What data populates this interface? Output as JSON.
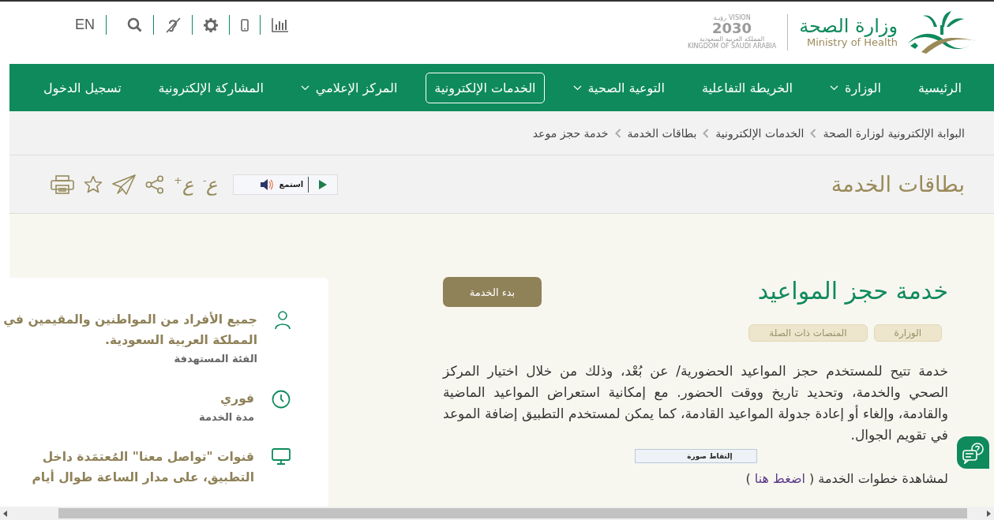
{
  "header": {
    "logo_ar": "وزارة الصحة",
    "logo_en": "Ministry of Health",
    "vision_en": "VISION",
    "vision_ar": "رؤيـة",
    "vision_year": "2030",
    "vision_sub_ar": "المملكة العربية السعودية",
    "vision_sub_en": "KINGDOM OF SAUDI ARABIA"
  },
  "toolbar": {
    "language": "EN"
  },
  "nav": [
    {
      "label": "الرئيسية",
      "dropdown": false,
      "selected": false
    },
    {
      "label": "الوزارة",
      "dropdown": true,
      "selected": false
    },
    {
      "label": "الخريطة التفاعلية",
      "dropdown": false,
      "selected": false
    },
    {
      "label": "التوعية الصحية",
      "dropdown": true,
      "selected": false
    },
    {
      "label": "الخدمات الإلكترونية",
      "dropdown": false,
      "selected": true
    },
    {
      "label": "المركز الإعلامي",
      "dropdown": true,
      "selected": false
    },
    {
      "label": "المشاركة الإلكترونية",
      "dropdown": false,
      "selected": false
    },
    {
      "label": "تسجيل الدخول",
      "dropdown": false,
      "selected": false
    }
  ],
  "breadcrumb": [
    "البوابة الإلكترونية لوزارة الصحة",
    "الخدمات الإلكترونية",
    "بطاقات الخدمة",
    "خدمة حجز موعد"
  ],
  "page_title": "بطاقات الخدمة",
  "listen": {
    "label": "استمع"
  },
  "font_controls": [
    {
      "glyph": "ع",
      "sign": "-"
    },
    {
      "glyph": "ع",
      "sign": "+"
    }
  ],
  "service": {
    "title": "خدمة حجز المواعيد",
    "start_button": "بدء الخدمة",
    "tags": [
      "الوزارة",
      "المنصات ذات الصلة"
    ],
    "description": "خدمة تتيح للمستخدم حجز المواعيد الحضورية/ عن بُعْد، وذلك من خلال اختيار المركز الصحي والخدمة، وتحديد تاريخ ووقت الحضور. مع إمكانية استعراض المواعيد الماضية والقادمة، وإلغاء أو إعادة جدولة المواعيد القادمة، كما يمكن لمستخدم التطبيق إضافة الموعد في تقويم الجوال.",
    "steps_prefix": "لمشاهدة خطوات الخدمة (",
    "steps_link": "اضغط هنا",
    "steps_suffix": ")"
  },
  "details": [
    {
      "kind": "audience",
      "value": "جميع الأفراد من المواطنين والمقيمين في المملكة العربية السعودية.",
      "label": "الفئة المستهدفة"
    },
    {
      "kind": "duration",
      "value": "فوري",
      "label": "مدة الخدمة"
    },
    {
      "kind": "channels",
      "value": "قنوات \"تواصل معنا\" المُعتمَدة داخل التطبيق، على مدار الساعة طوال أيام"
    }
  ],
  "tooltip": "إلتقاط صورة"
}
